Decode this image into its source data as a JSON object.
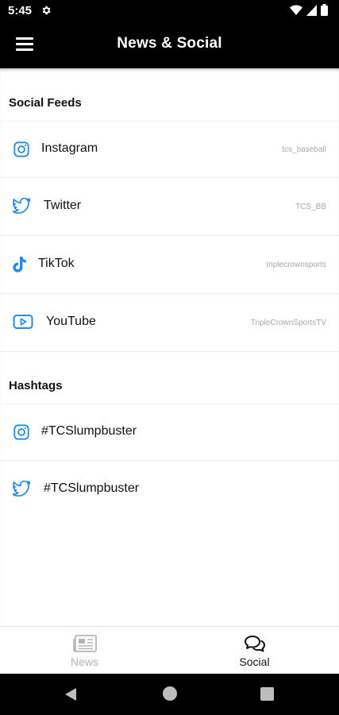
{
  "status_bar": {
    "time": "5:45"
  },
  "app_bar": {
    "title": "News & Social"
  },
  "sections": {
    "social_feeds": {
      "title": "Social Feeds",
      "items": [
        {
          "label": "Instagram",
          "handle": "tcs_baseball",
          "icon": "instagram-icon"
        },
        {
          "label": "Twitter",
          "handle": "TCS_BB",
          "icon": "twitter-icon"
        },
        {
          "label": "TikTok",
          "handle": "triplecrownsports",
          "icon": "tiktok-icon"
        },
        {
          "label": "YouTube",
          "handle": "TripleCrownSportsTV",
          "icon": "youtube-icon"
        }
      ]
    },
    "hashtags": {
      "title": "Hashtags",
      "items": [
        {
          "label": "#TCSlumpbuster",
          "icon": "instagram-icon"
        },
        {
          "label": "#TCSlumpbuster",
          "icon": "twitter-icon"
        }
      ]
    }
  },
  "tab_bar": {
    "tabs": [
      {
        "label": "News",
        "icon": "newspaper-icon",
        "active": false
      },
      {
        "label": "Social",
        "icon": "chat-bubbles-icon",
        "active": true
      }
    ]
  },
  "colors": {
    "accent_blue": "#1d8bf0",
    "header_bg": "#000000",
    "inactive_tab": "#b5b5b5",
    "active_tab": "#111111"
  }
}
